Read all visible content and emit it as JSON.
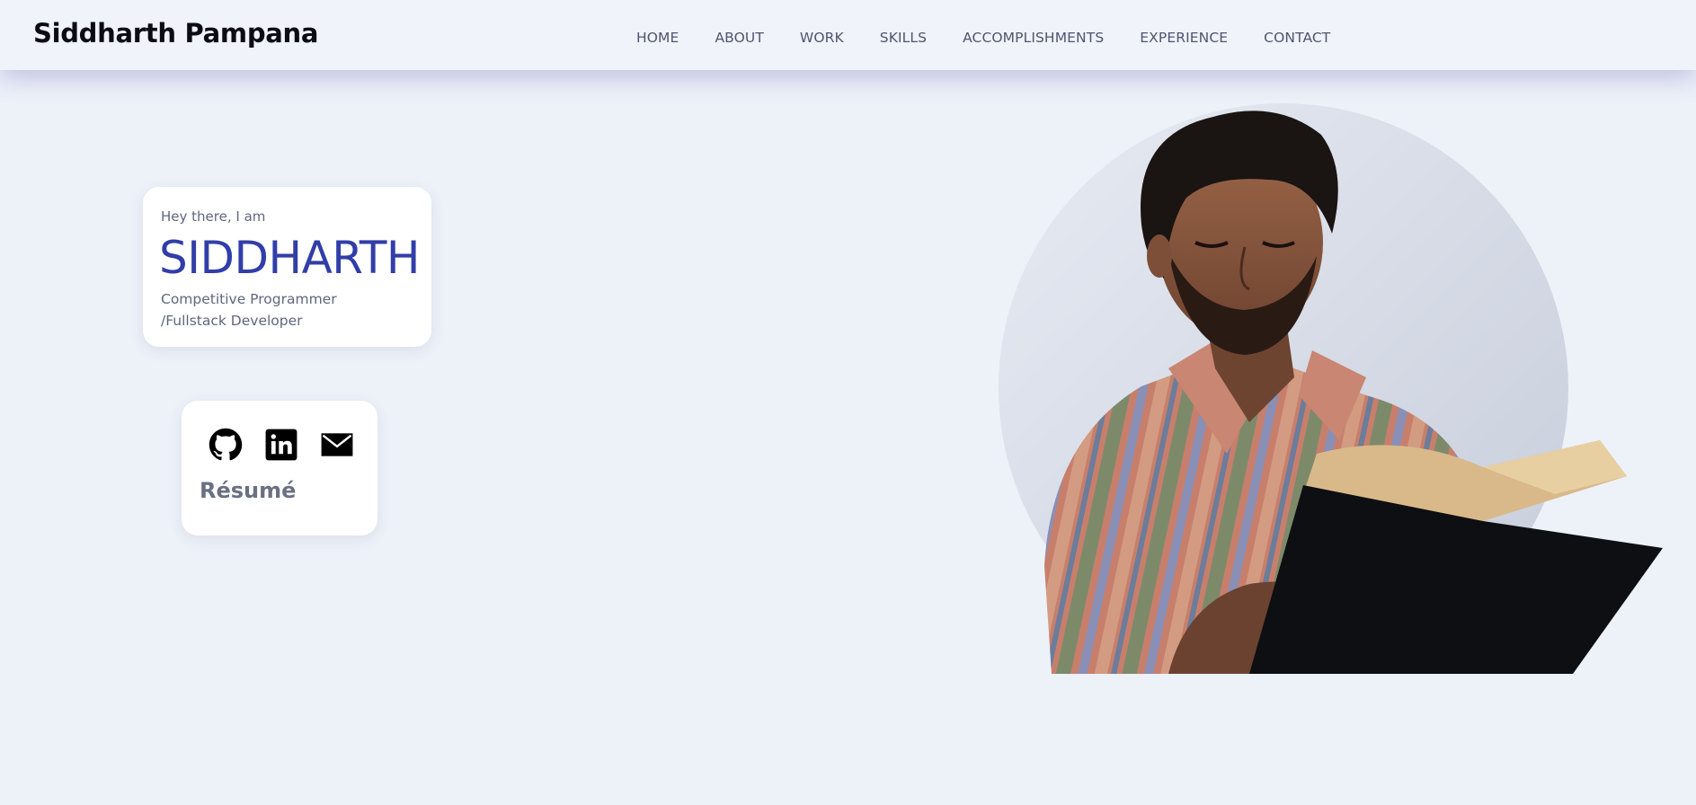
{
  "header": {
    "brand": "Siddharth Pampana",
    "nav": [
      {
        "label": "HOME"
      },
      {
        "label": "ABOUT"
      },
      {
        "label": "WORK"
      },
      {
        "label": "SKILLS"
      },
      {
        "label": "ACCOMPLISHMENTS"
      },
      {
        "label": "EXPERIENCE"
      },
      {
        "label": "CONTACT"
      }
    ]
  },
  "hero": {
    "greeting": "Hey there, I am",
    "first_name": "SIDDHARTH",
    "role_line1": "Competitive Programmer",
    "role_line2": "/Fullstack Developer"
  },
  "links": {
    "icons": [
      "github-icon",
      "linkedin-icon",
      "mail-icon"
    ],
    "resume_label": "Résumé"
  },
  "colors": {
    "page_background": "#edf1f8",
    "navbar_background": "#f0f3f9",
    "accent_name": "#313ea8",
    "muted_text": "#60677d",
    "card_background": "#ffffff"
  }
}
